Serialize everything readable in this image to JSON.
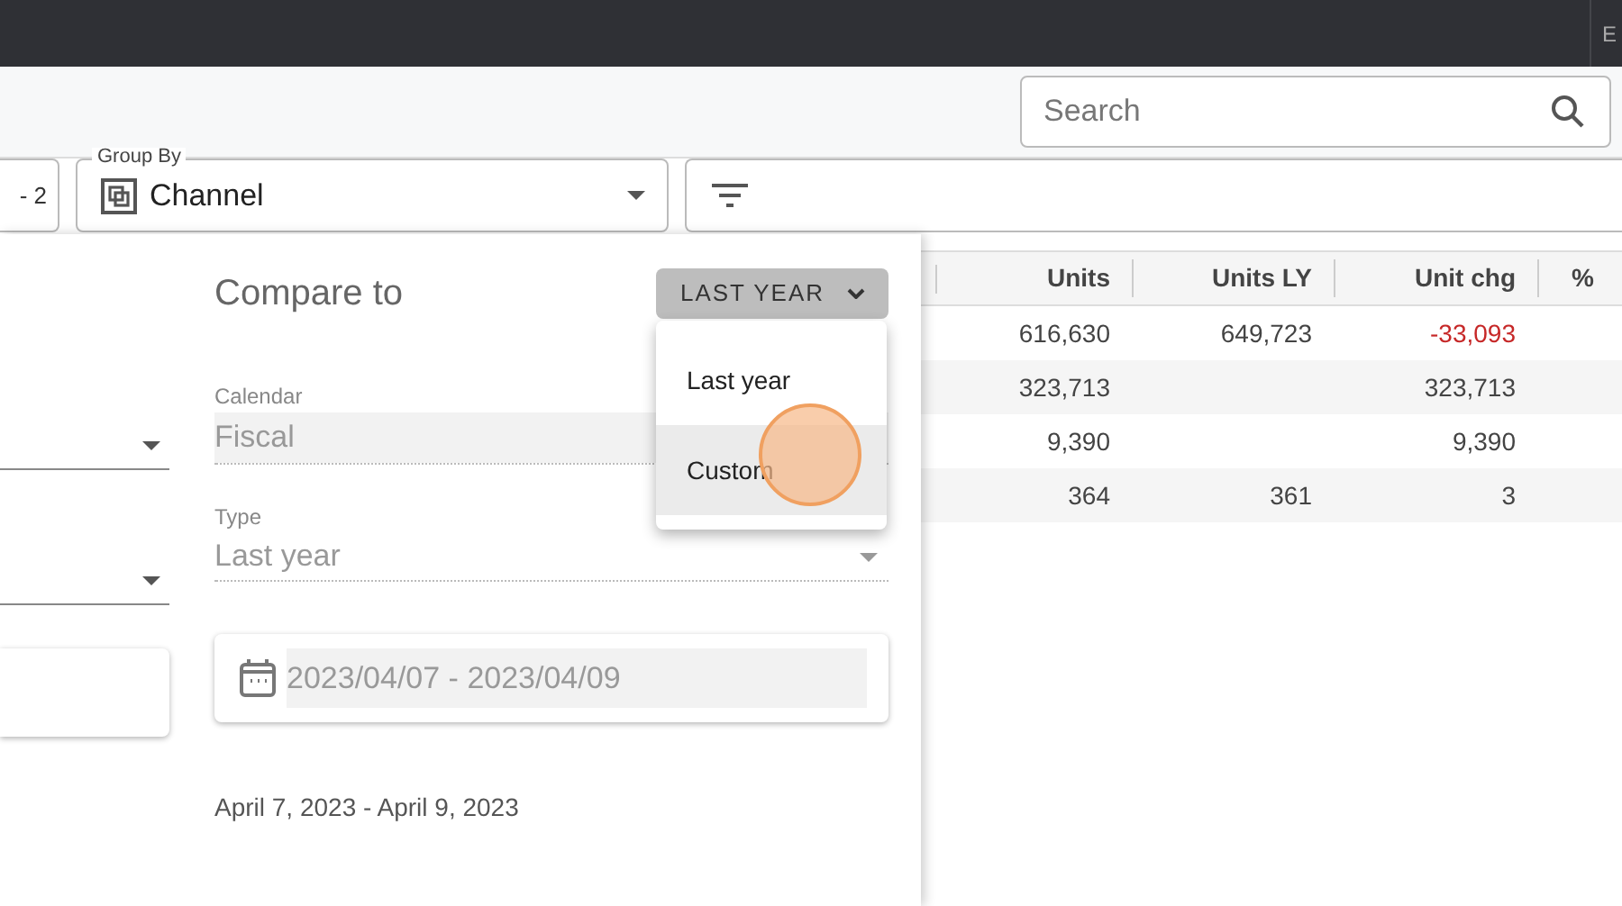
{
  "top_bar": {
    "text": "E"
  },
  "search": {
    "placeholder": "Search"
  },
  "filters": {
    "date_field": {
      "value": "- 2"
    },
    "group_by": {
      "label": "Group By",
      "value": "Channel"
    }
  },
  "compare_panel": {
    "title": "Compare to",
    "mode_button": {
      "label": "LAST YEAR",
      "expanded": true
    },
    "menu": [
      {
        "label": "Last year",
        "highlighted": false
      },
      {
        "label": "Custom",
        "highlighted": true
      }
    ],
    "calendar": {
      "label": "Calendar",
      "value": "Fiscal",
      "disabled": true
    },
    "type": {
      "label": "Type",
      "value": "Last year",
      "disabled": true
    },
    "date_range": {
      "value": "2023/04/07 - 2023/04/09"
    },
    "summary": "April 7, 2023 - April 9, 2023"
  },
  "table": {
    "columns": [
      "Units",
      "Units LY",
      "Unit chg",
      "%"
    ],
    "rows": [
      {
        "units": "616,630",
        "units_ly": "649,723",
        "unit_chg": "-33,093",
        "negative": true
      },
      {
        "units": "323,713",
        "unit_chg": "323,713",
        "negative": false
      },
      {
        "units": "9,390",
        "unit_chg": "9,390",
        "negative": false
      },
      {
        "units": "364",
        "units_ly": "361",
        "unit_chg": "3",
        "negative": false
      }
    ]
  }
}
